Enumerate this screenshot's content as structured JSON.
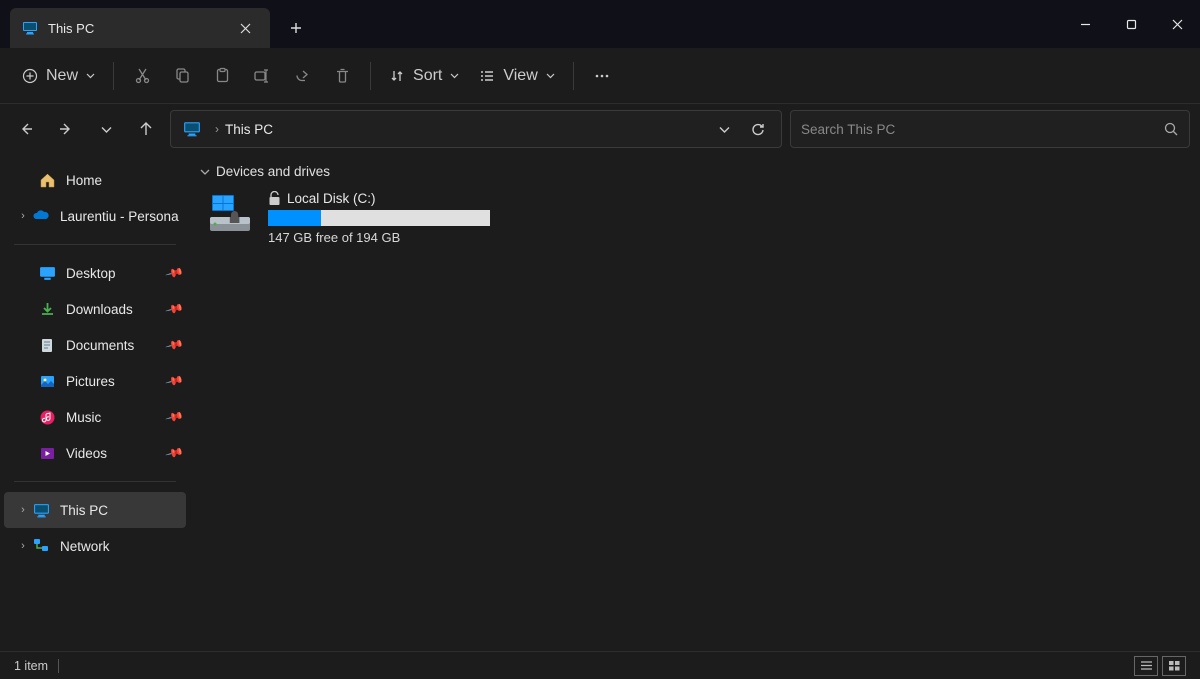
{
  "tab": {
    "title": "This PC"
  },
  "toolbar": {
    "new_label": "New",
    "sort_label": "Sort",
    "view_label": "View"
  },
  "address": {
    "location": "This PC"
  },
  "search": {
    "placeholder": "Search This PC"
  },
  "sidebar": {
    "home": "Home",
    "personal": "Laurentiu - Persona",
    "desktop": "Desktop",
    "downloads": "Downloads",
    "documents": "Documents",
    "pictures": "Pictures",
    "music": "Music",
    "videos": "Videos",
    "this_pc": "This PC",
    "network": "Network"
  },
  "content": {
    "group_header": "Devices and drives",
    "drive": {
      "name": "Local Disk (C:)",
      "subtext": "147 GB free of 194 GB",
      "used_percent": 24
    }
  },
  "status": {
    "item_count": "1 item"
  },
  "colors": {
    "accent": "#0091ff"
  }
}
